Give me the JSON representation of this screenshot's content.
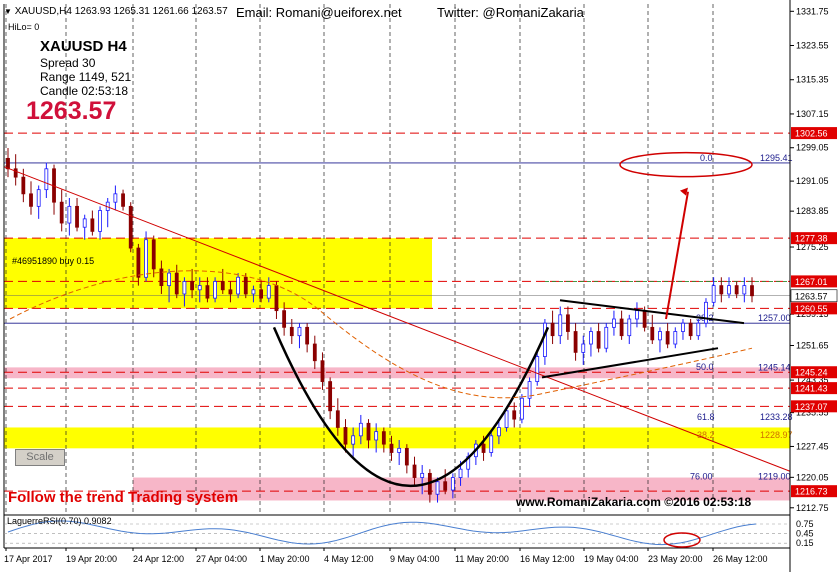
{
  "header": {
    "symbol_line": "XAUUSD,H4  1263.93 1265.31 1261.66 1263.57",
    "email": "Email:   Romani@ueiforex.net",
    "twitter": "Twitter:   @RomaniZakaria",
    "hilo": "HiLo= 0"
  },
  "info_panel": {
    "title": "XAUUSD   H4",
    "spread": "Spread   30",
    "range": "Range   1149, 521",
    "candle": "Candle   02:53:18",
    "price": "1263.57"
  },
  "buy_label": "#46951890 buy 0.15",
  "scale_button": "Scale",
  "footer_left": "Follow the trend Trading system",
  "footer_right": "www.RomaniZakaria.com  ©2016  02:53:18",
  "indicator_label": "LaguerreRSI(0.70) 0.9082",
  "colors": {
    "bull": "#1a1aff",
    "bear": "#8a0000",
    "yellow_zone": "#ffff00",
    "pink_zone": "#f7b6c8",
    "red_line": "#e00000",
    "blue_line": "#1a1a8c",
    "price_label_bg": "#e00000"
  },
  "chart_data": {
    "type": "candlestick",
    "title": "XAUUSD, H4",
    "ylim": [
      1211.5,
      1333.5
    ],
    "y_ticks": [
      1331.75,
      1323.55,
      1315.35,
      1307.15,
      1299.05,
      1291.05,
      1283.85,
      1275.25,
      1259.15,
      1251.65,
      1243.35,
      1235.55,
      1227.45,
      1220.05,
      1212.75
    ],
    "x_ticks": [
      "17 Apr 2017",
      "19 Apr 20:00",
      "24 Apr 12:00",
      "27 Apr 04:00",
      "1 May 20:00",
      "4 May 12:00",
      "9 May 04:00",
      "11 May 20:00",
      "16 May 12:00",
      "19 May 04:00",
      "23 May 20:00",
      "26 May 12:00"
    ],
    "horizontal_levels": [
      {
        "price": 1302.56,
        "label": "1302.56",
        "style": "red-dash"
      },
      {
        "price": 1295.41,
        "label": "1295.41",
        "style": "blue-solid"
      },
      {
        "price": 1277.38,
        "label": "1277.38",
        "style": "red-dash"
      },
      {
        "price": 1267.01,
        "label": "1267.01",
        "style": "red-label"
      },
      {
        "price": 1263.57,
        "label": "1263.57",
        "style": "current"
      },
      {
        "price": 1260.55,
        "label": "1260.55",
        "style": "red-dash"
      },
      {
        "price": 1257.0,
        "label": "1257.00",
        "style": "blue-solid"
      },
      {
        "price": 1245.24,
        "label": "1245.24",
        "style": "red-label"
      },
      {
        "price": 1245.14,
        "label": "1245.14",
        "style": "blue-text"
      },
      {
        "price": 1241.43,
        "label": "1241.43",
        "style": "red-dash"
      },
      {
        "price": 1237.07,
        "label": "1237.07",
        "style": "red-dash"
      },
      {
        "price": 1233.28,
        "label": "1233.28",
        "style": "blue-text"
      },
      {
        "price": 1228.97,
        "label": "1228.97",
        "style": "orange-text"
      },
      {
        "price": 1219.0,
        "label": "1219.00",
        "style": "blue-text"
      },
      {
        "price": 1216.73,
        "label": "1216.73",
        "style": "red-label"
      }
    ],
    "fib_labels": [
      {
        "text": "0.0",
        "price": 1295.41
      },
      {
        "text": "50.0",
        "price": 1245.24
      },
      {
        "text": "61.8",
        "price": 1233.28
      },
      {
        "text": "38.2",
        "price": 1228.97
      },
      {
        "text": "76.00",
        "price": 1219.0
      },
      {
        "text": "38.2",
        "price": 1257.0
      }
    ],
    "zones": [
      {
        "from": 1260.55,
        "to": 1277.38,
        "color": "yellow"
      },
      {
        "from": 1227.0,
        "to": 1232.0,
        "color": "yellow"
      },
      {
        "from": 1243.8,
        "to": 1246.4,
        "color": "pink"
      },
      {
        "from": 1214.5,
        "to": 1220.0,
        "color": "pink"
      }
    ],
    "candles": [
      [
        1296.5,
        1299.0,
        1292.0,
        1294.0
      ],
      [
        1294.0,
        1297.5,
        1290.0,
        1292.0
      ],
      [
        1292.0,
        1294.0,
        1286.0,
        1288.0
      ],
      [
        1288.0,
        1291.0,
        1283.0,
        1285.0
      ],
      [
        1285.0,
        1290.0,
        1282.0,
        1289.0
      ],
      [
        1289.0,
        1295.5,
        1287.0,
        1294.0
      ],
      [
        1294.0,
        1295.0,
        1283.0,
        1286.0
      ],
      [
        1286.0,
        1289.0,
        1279.0,
        1281.0
      ],
      [
        1281.0,
        1287.0,
        1278.0,
        1285.0
      ],
      [
        1285.0,
        1287.0,
        1279.0,
        1280.0
      ],
      [
        1280.0,
        1283.0,
        1277.0,
        1282.0
      ],
      [
        1282.0,
        1284.0,
        1278.0,
        1279.0
      ],
      [
        1279.0,
        1285.0,
        1277.0,
        1284.0
      ],
      [
        1284.0,
        1287.0,
        1280.0,
        1286.0
      ],
      [
        1286.0,
        1290.0,
        1284.0,
        1288.0
      ],
      [
        1288.0,
        1289.0,
        1284.0,
        1285.0
      ],
      [
        1285.0,
        1286.0,
        1274.0,
        1275.0
      ],
      [
        1275.0,
        1276.0,
        1266.0,
        1268.0
      ],
      [
        1268.0,
        1279.0,
        1267.0,
        1277.0
      ],
      [
        1277.0,
        1278.0,
        1268.0,
        1270.0
      ],
      [
        1270.0,
        1272.0,
        1264.0,
        1266.0
      ],
      [
        1266.0,
        1270.0,
        1262.0,
        1269.0
      ],
      [
        1269.0,
        1271.0,
        1263.0,
        1264.0
      ],
      [
        1264.0,
        1268.0,
        1261.0,
        1267.0
      ],
      [
        1267.0,
        1270.0,
        1263.0,
        1265.0
      ],
      [
        1265.0,
        1268.0,
        1262.0,
        1266.0
      ],
      [
        1266.0,
        1268.0,
        1262.0,
        1263.0
      ],
      [
        1263.0,
        1268.0,
        1262.0,
        1267.0
      ],
      [
        1267.0,
        1270.0,
        1264.0,
        1265.0
      ],
      [
        1265.0,
        1267.0,
        1262.0,
        1264.0
      ],
      [
        1264.0,
        1269.0,
        1263.0,
        1268.0
      ],
      [
        1268.0,
        1269.0,
        1263.0,
        1264.0
      ],
      [
        1264.0,
        1266.0,
        1262.0,
        1265.0
      ],
      [
        1265.0,
        1267.0,
        1262.0,
        1263.0
      ],
      [
        1263.0,
        1268.0,
        1262.0,
        1266.0
      ],
      [
        1266.0,
        1267.0,
        1258.0,
        1260.0
      ],
      [
        1260.0,
        1262.0,
        1254.0,
        1256.0
      ],
      [
        1256.0,
        1258.0,
        1252.0,
        1254.0
      ],
      [
        1254.0,
        1257.0,
        1251.0,
        1256.0
      ],
      [
        1256.0,
        1257.0,
        1250.0,
        1252.0
      ],
      [
        1252.0,
        1254.0,
        1246.0,
        1248.0
      ],
      [
        1248.0,
        1250.0,
        1241.0,
        1243.0
      ],
      [
        1243.0,
        1244.0,
        1234.0,
        1236.0
      ],
      [
        1236.0,
        1239.0,
        1230.0,
        1232.0
      ],
      [
        1232.0,
        1234.0,
        1226.0,
        1228.0
      ],
      [
        1228.0,
        1232.0,
        1225.0,
        1230.0
      ],
      [
        1230.0,
        1235.0,
        1228.0,
        1233.0
      ],
      [
        1233.0,
        1234.0,
        1227.0,
        1229.0
      ],
      [
        1229.0,
        1233.0,
        1226.0,
        1231.0
      ],
      [
        1231.0,
        1232.0,
        1226.0,
        1228.0
      ],
      [
        1228.0,
        1230.0,
        1224.0,
        1226.0
      ],
      [
        1226.0,
        1229.0,
        1223.0,
        1227.0
      ],
      [
        1227.0,
        1228.0,
        1221.0,
        1223.0
      ],
      [
        1223.0,
        1225.0,
        1218.0,
        1220.0
      ],
      [
        1220.0,
        1223.0,
        1216.0,
        1221.0
      ],
      [
        1221.0,
        1222.0,
        1214.0,
        1216.0
      ],
      [
        1216.0,
        1220.0,
        1214.0,
        1219.0
      ],
      [
        1219.0,
        1222.0,
        1216.0,
        1217.0
      ],
      [
        1217.0,
        1221.0,
        1215.0,
        1220.0
      ],
      [
        1220.0,
        1224.0,
        1218.0,
        1222.0
      ],
      [
        1222.0,
        1226.0,
        1220.0,
        1225.0
      ],
      [
        1225.0,
        1229.0,
        1223.0,
        1228.0
      ],
      [
        1228.0,
        1230.0,
        1224.0,
        1226.0
      ],
      [
        1226.0,
        1231.0,
        1225.0,
        1230.0
      ],
      [
        1230.0,
        1234.0,
        1228.0,
        1232.0
      ],
      [
        1232.0,
        1237.0,
        1231.0,
        1236.0
      ],
      [
        1236.0,
        1238.0,
        1232.0,
        1234.0
      ],
      [
        1234.0,
        1240.0,
        1233.0,
        1239.0
      ],
      [
        1239.0,
        1244.0,
        1237.0,
        1243.0
      ],
      [
        1243.0,
        1250.0,
        1242.0,
        1249.0
      ],
      [
        1249.0,
        1258.0,
        1247.0,
        1257.0
      ],
      [
        1257.0,
        1260.0,
        1252.0,
        1254.0
      ],
      [
        1254.0,
        1261.0,
        1252.0,
        1259.0
      ],
      [
        1259.0,
        1261.0,
        1253.0,
        1255.0
      ],
      [
        1255.0,
        1257.0,
        1248.0,
        1250.0
      ],
      [
        1250.0,
        1254.0,
        1247.0,
        1252.0
      ],
      [
        1252.0,
        1256.0,
        1249.0,
        1255.0
      ],
      [
        1255.0,
        1257.0,
        1250.0,
        1251.0
      ],
      [
        1251.0,
        1257.0,
        1250.0,
        1256.0
      ],
      [
        1256.0,
        1260.0,
        1254.0,
        1258.0
      ],
      [
        1258.0,
        1260.0,
        1253.0,
        1254.0
      ],
      [
        1254.0,
        1259.0,
        1252.0,
        1258.0
      ],
      [
        1258.0,
        1262.0,
        1256.0,
        1260.0
      ],
      [
        1260.0,
        1261.0,
        1255.0,
        1256.0
      ],
      [
        1256.0,
        1259.0,
        1252.0,
        1253.0
      ],
      [
        1253.0,
        1256.0,
        1250.0,
        1255.0
      ],
      [
        1255.0,
        1257.0,
        1251.0,
        1252.0
      ],
      [
        1252.0,
        1256.0,
        1251.0,
        1255.0
      ],
      [
        1255.0,
        1258.0,
        1253.0,
        1257.0
      ],
      [
        1257.0,
        1258.0,
        1253.0,
        1254.0
      ],
      [
        1254.0,
        1258.0,
        1253.0,
        1257.0
      ],
      [
        1257.0,
        1263.0,
        1256.0,
        1262.0
      ],
      [
        1262.0,
        1268.0,
        1261.0,
        1266.0
      ],
      [
        1266.0,
        1268.0,
        1262.0,
        1264.0
      ],
      [
        1264.0,
        1268.0,
        1263.0,
        1266.0
      ],
      [
        1266.0,
        1267.0,
        1263.0,
        1264.0
      ],
      [
        1264.0,
        1268.0,
        1262.0,
        1266.0
      ],
      [
        1266.0,
        1268.0,
        1262.0,
        1263.57
      ]
    ],
    "trendlines": [
      {
        "from": [
          "17 Apr",
          1294.5
        ],
        "to": [
          "26 May",
          1221.5
        ],
        "color": "red"
      },
      {
        "from": [
          "19 May",
          1262.5
        ],
        "to": [
          "26 May",
          1257.0
        ],
        "color": "black"
      },
      {
        "from": [
          "16 May",
          1244.0
        ],
        "to": [
          "26 May",
          1251.0
        ],
        "color": "black"
      }
    ],
    "indicator": {
      "name": "LaguerreRSI(0.70)",
      "value": 0.9082,
      "levels": [
        0.75,
        0.45,
        0.15
      ],
      "tick_labels": [
        "0.75",
        "0.45",
        "0.15"
      ]
    },
    "grid": true
  }
}
